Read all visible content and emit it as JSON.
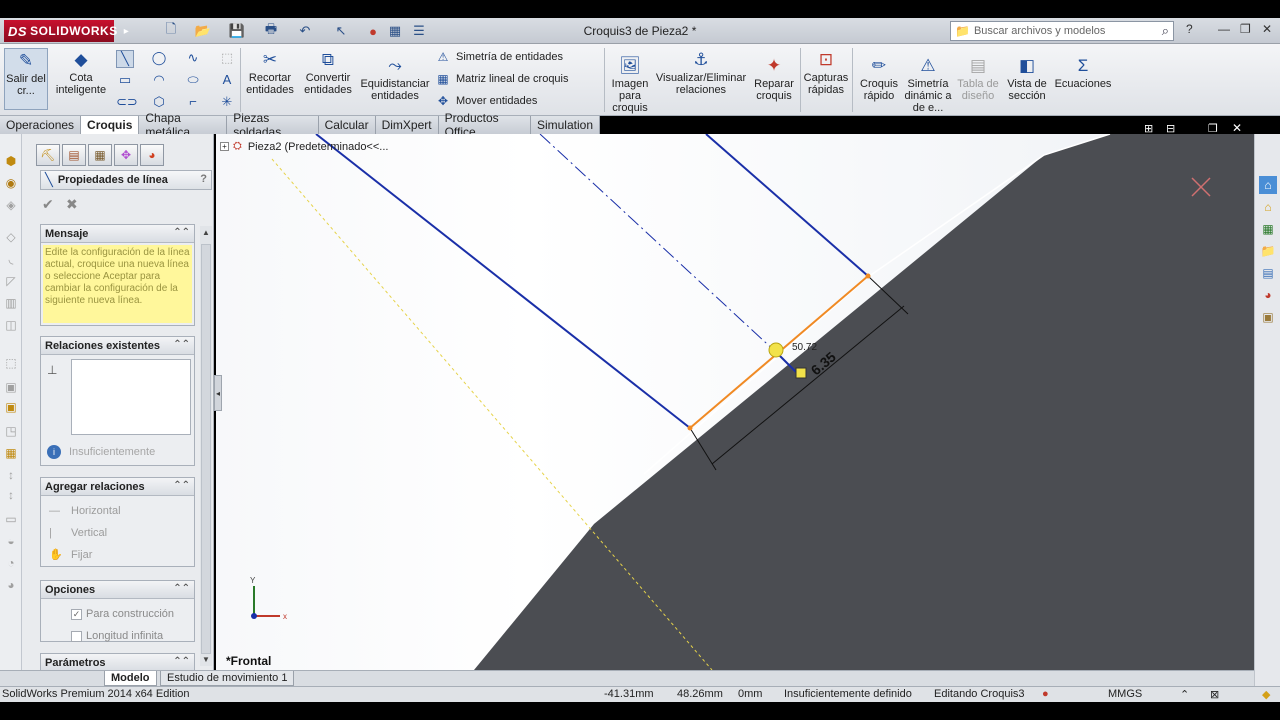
{
  "app": {
    "brand": "SOLIDWORKS",
    "document_title": "Croquis3 de Pieza2 *",
    "search_placeholder": "Buscar archivos y modelos",
    "help_label": "?"
  },
  "ribbon": {
    "exit_sketch": "Salir del cr...",
    "smart_dimension": "Cota inteligente",
    "trim": "Recortar entidades",
    "convert": "Convertir entidades",
    "offset": "Equidistanciar entidades",
    "mirror": "Simetría de entidades",
    "linear_pattern": "Matriz lineal de croquis",
    "move": "Mover entidades",
    "sketch_picture": "Imagen para croquis",
    "display_relations": "Visualizar/Eliminar relaciones",
    "repair": "Reparar croquis",
    "quick_snaps": "Capturas rápidas",
    "rapid_sketch": "Croquis rápido",
    "dynamic_mirror": "Simetría dinámic a de e...",
    "design_table": "Tabla de diseño",
    "section_view": "Vista de sección",
    "equations": "Ecuaciones"
  },
  "tabs": [
    "Operaciones",
    "Croquis",
    "Chapa metálica",
    "Piezas soldadas",
    "Calcular",
    "DimXpert",
    "Productos Office",
    "Simulation"
  ],
  "active_tab": "Croquis",
  "property_manager": {
    "title": "Propiedades de línea",
    "help": "?",
    "message_header": "Mensaje",
    "message_text": "Edite la configuración de la línea actual, croquice una nueva línea o seleccione Aceptar para cambiar la configuración de la siguiente nueva línea.",
    "existing_relations_header": "Relaciones existentes",
    "status_text": "Insuficientemente",
    "add_relations_header": "Agregar relaciones",
    "relations": [
      "Horizontal",
      "Vertical",
      "Fijar"
    ],
    "options_header": "Opciones",
    "option_construction": "Para construcción",
    "option_infinite": "Longitud infinita",
    "params_header": "Parámetros"
  },
  "viewport": {
    "tree_item": "Pieza2  (Predeterminado<<...",
    "view_name": "*Frontal",
    "dim_main": "6.35",
    "dim_angle": "50.72",
    "triad_x": "x",
    "triad_y": "Y"
  },
  "bottom_tabs": [
    "Modelo",
    "Estudio de movimiento 1"
  ],
  "status": {
    "edition": "SolidWorks Premium 2014 x64 Edition",
    "x": "-41.31mm",
    "y": "48.26mm",
    "z": "0mm",
    "definition": "Insuficientemente definido",
    "editing": "Editando Croquis3",
    "units": "MMGS"
  }
}
